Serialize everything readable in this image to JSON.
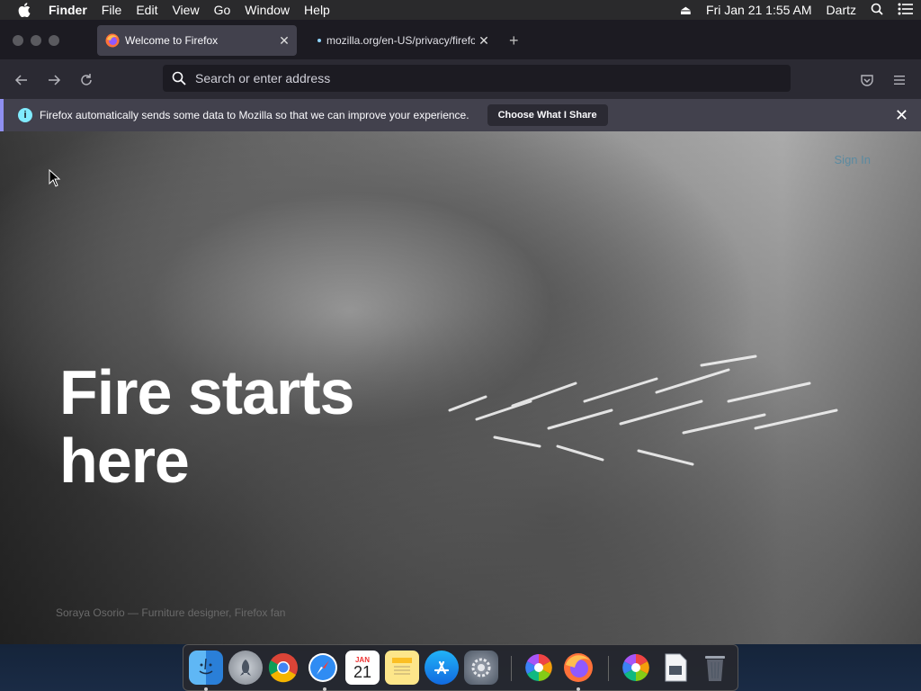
{
  "menubar": {
    "app": "Finder",
    "items": [
      "File",
      "Edit",
      "View",
      "Go",
      "Window",
      "Help"
    ],
    "datetime": "Fri Jan 21  1:55 AM",
    "user": "Dartz"
  },
  "tabs": [
    {
      "title": "Welcome to Firefox",
      "active": true
    },
    {
      "title": "mozilla.org/en-US/privacy/firefox",
      "active": false
    }
  ],
  "urlbar": {
    "placeholder": "Search or enter address"
  },
  "notice": {
    "message": "Firefox automatically sends some data to Mozilla so that we can improve your experience.",
    "button": "Choose What I Share"
  },
  "hero": {
    "signin": "Sign In",
    "headline_line1": "Fire starts",
    "headline_line2": "here",
    "credit": "Soraya Osorio — Furniture designer, Firefox fan"
  },
  "dock": {
    "calendar_month": "JAN",
    "calendar_day": "21",
    "apps": [
      "finder",
      "launchpad",
      "chrome",
      "safari",
      "calendar",
      "notes",
      "app-store",
      "system-preferences",
      "photos-pinwheel",
      "firefox",
      "photos-pinwheel-2",
      "preview",
      "trash"
    ]
  },
  "colors": {
    "accent": "#8f8ff0",
    "info": "#80ebff",
    "chrome_bg": "#2b2a33"
  }
}
